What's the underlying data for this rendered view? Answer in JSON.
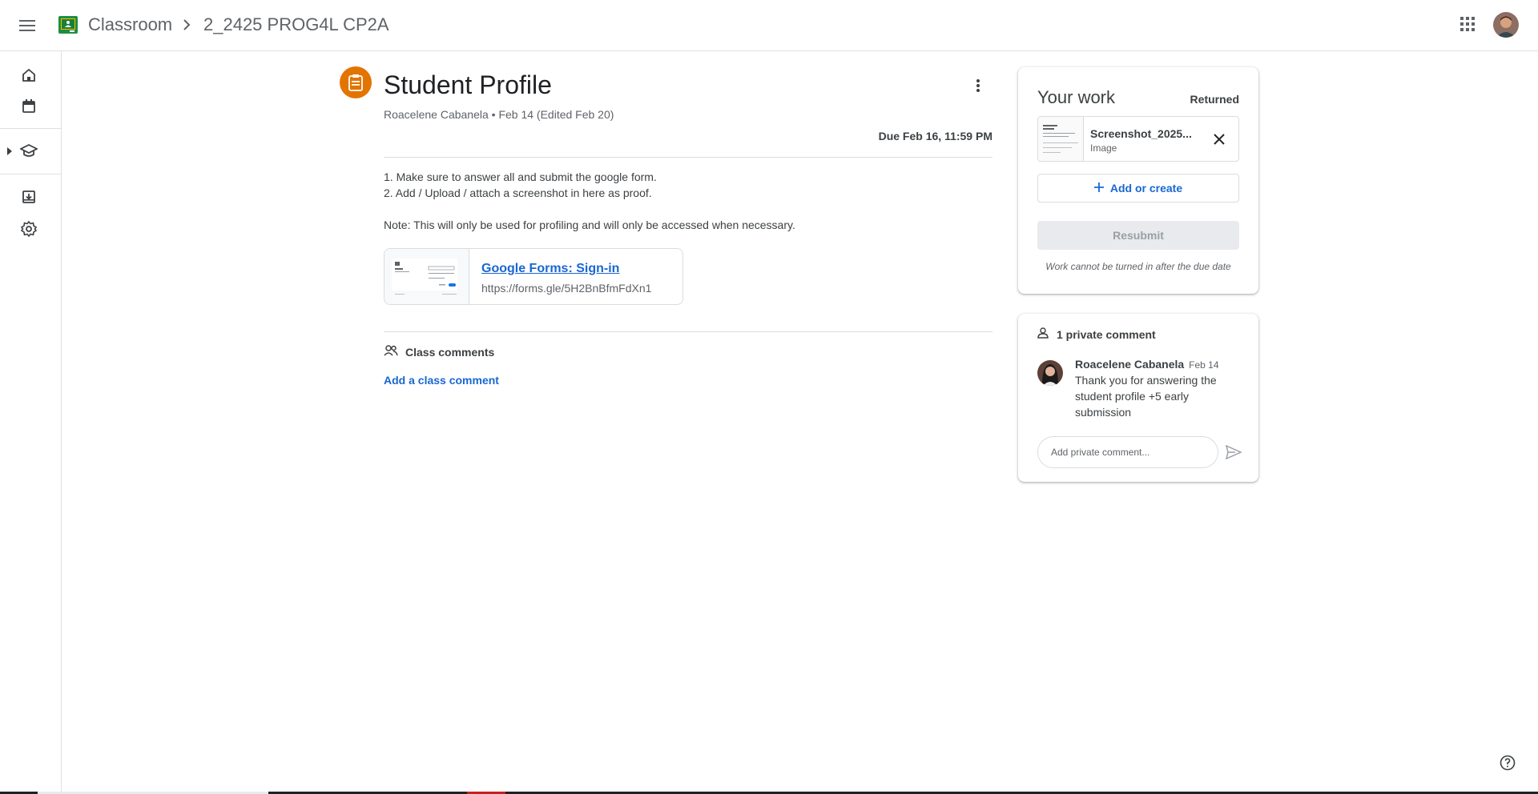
{
  "header": {
    "app_title": "Classroom",
    "class_title": "2_2425 PROG4L CP2A",
    "menu_icon": "hamburger-menu-icon",
    "apps_icon": "google-apps-icon",
    "logo_color": "#1e8e3e"
  },
  "rail": {
    "items": [
      {
        "name": "home-icon"
      },
      {
        "name": "calendar-icon"
      },
      {
        "name": "enrolled-classes-icon"
      },
      {
        "name": "archived-classes-icon"
      },
      {
        "name": "settings-icon"
      }
    ]
  },
  "post": {
    "title": "Student Profile",
    "meta": "Roacelene Cabanela • Feb 14 (Edited Feb 20)",
    "due": "Due Feb 16, 11:59 PM",
    "instructions": [
      "1. Make sure to answer all and submit the google form.",
      "2. Add / Upload / attach a screenshot in here as proof.",
      "Note: This will only be used for profiling and will only be accessed when necessary."
    ],
    "attachment": {
      "title": "Google Forms: Sign-in",
      "url": "https://forms.gle/5H2BnBfmFdXn1"
    },
    "class_comments_label": "Class comments",
    "add_class_comment_label": "Add a class comment",
    "accent_color": "#e37400"
  },
  "your_work": {
    "title": "Your work",
    "status": "Returned",
    "file": {
      "name": "Screenshot_2025...",
      "type": "Image"
    },
    "add_or_create_label": "Add or create",
    "resubmit_label": "Resubmit",
    "late_note": "Work cannot be turned in after the due date"
  },
  "private_comments": {
    "header": "1 private comment",
    "comments": [
      {
        "author": "Roacelene Cabanela",
        "date": "Feb 14",
        "text": "Thank you for answering the student profile +5 early submission"
      }
    ],
    "input_placeholder": "Add private comment..."
  },
  "colors": {
    "link_blue": "#1967d2",
    "text": "#3c4043",
    "muted": "#5f6368",
    "divider": "#dadce0"
  }
}
